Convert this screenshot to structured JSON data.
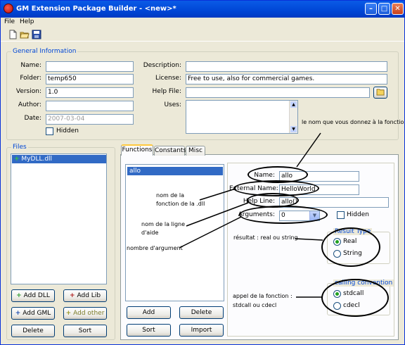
{
  "window": {
    "title": "GM Extension Package Builder - <new>*"
  },
  "menu": [
    "File",
    "Help"
  ],
  "general": {
    "legend": "General Information",
    "name_label": "Name:",
    "name_value": "",
    "folder_label": "Folder:",
    "folder_value": "temp650",
    "version_label": "Version:",
    "version_value": "1.0",
    "author_label": "Author:",
    "author_value": "",
    "date_label": "Date:",
    "date_value": "2007-03-04",
    "hidden_label": "Hidden",
    "description_label": "Description:",
    "description_value": "",
    "license_label": "License:",
    "license_value": "Free to use, also for commercial games.",
    "helpfile_label": "Help File:",
    "helpfile_value": "",
    "uses_label": "Uses:"
  },
  "files": {
    "legend": "Files",
    "items": [
      "MyDLL.dll"
    ],
    "buttons": {
      "add_dll": "Add DLL",
      "add_lib": "Add Lib",
      "add_gml": "Add GML",
      "add_other": "Add other",
      "delete": "Delete",
      "sort": "Sort"
    }
  },
  "tabs": [
    "Functions",
    "Constants",
    "Misc"
  ],
  "functions": {
    "items": [
      "allo"
    ],
    "buttons": {
      "add": "Add",
      "delete": "Delete",
      "sort": "Sort",
      "import": "Import"
    },
    "name_label": "Name:",
    "name_value": "allo",
    "external_label": "External Name:",
    "external_value": "HelloWorld",
    "helpline_label": "Help Line:",
    "helpline_value": "allo()",
    "arguments_label": "Arguments:",
    "arguments_value": "0",
    "hidden_label": "Hidden",
    "result_legend": "Result Type",
    "result_real": "Real",
    "result_string": "String",
    "result_selected": "Real",
    "calling_legend": "calling convention",
    "calling_stdcall": "stdcall",
    "calling_cdecl": "cdecl",
    "calling_selected": "stdcall"
  },
  "annotations": {
    "name_note": "le nom que vous donnez à la fonction",
    "dll_note_1": "nom de la",
    "dll_note_2": "fonction de la .dll",
    "help_note_1": "nom de la ligne",
    "help_note_2": "d'aide",
    "args_note": "nombre d'argument",
    "result_note": "résultat : real ou string",
    "call_note_1": "appel de la fonction :",
    "call_note_2": "stdcall ou cdecl"
  },
  "colors": {
    "accent": "#0046D5",
    "selection": "#316AC5",
    "titlebar": "#0054E3"
  }
}
